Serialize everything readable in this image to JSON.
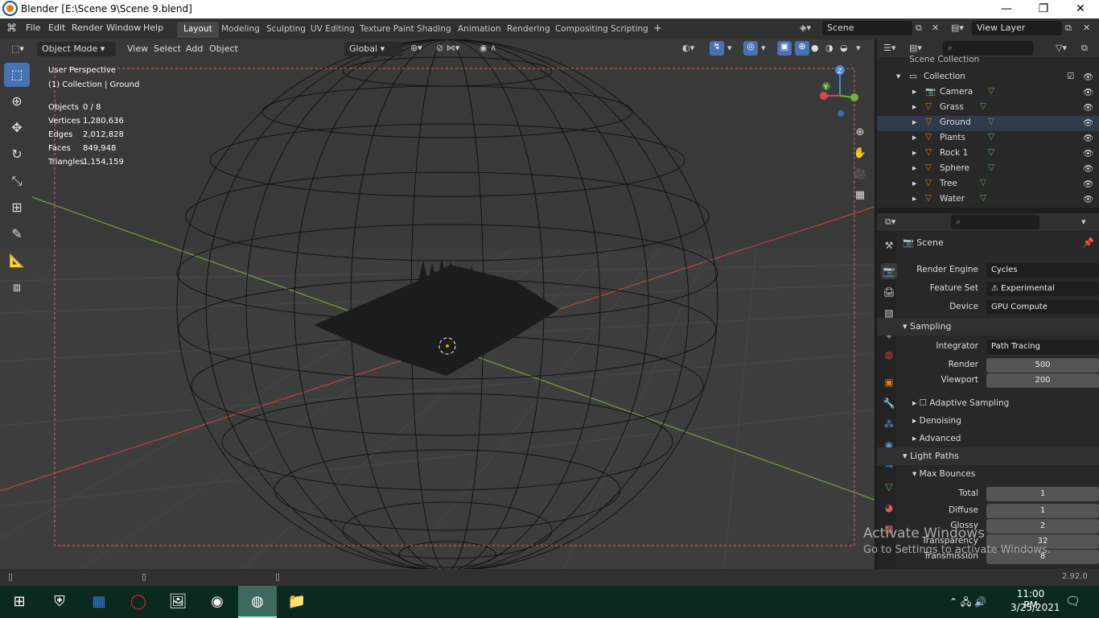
{
  "window": {
    "title": "Blender [E:\\Scene 9\\Scene 9.blend]"
  },
  "menus": [
    "File",
    "Edit",
    "Render",
    "Window",
    "Help"
  ],
  "workspaces": [
    "Layout",
    "Modeling",
    "Sculpting",
    "UV Editing",
    "Texture Paint",
    "Shading",
    "Animation",
    "Rendering",
    "Compositing",
    "Scripting"
  ],
  "scene_field": "Scene",
  "view_layer_field": "View Layer",
  "viewport_header": {
    "mode": "Object Mode",
    "view": "View",
    "select": "Select",
    "add": "Add",
    "object": "Object",
    "transform": "Global"
  },
  "overlay": {
    "perspective": "User Perspective",
    "collection_info": "(1) Collection | Ground",
    "stats": [
      {
        "label": "Objects",
        "value": "0 / 8"
      },
      {
        "label": "Vertices",
        "value": "1,280,636"
      },
      {
        "label": "Edges",
        "value": "2,012,828"
      },
      {
        "label": "Faces",
        "value": "849,948"
      },
      {
        "label": "Triangles",
        "value": "1,154,159"
      }
    ]
  },
  "outliner": {
    "root": "Scene Collection",
    "collection": "Collection",
    "items": [
      "Camera",
      "Grass",
      "Ground",
      "Plants",
      "Rock 1",
      "Sphere",
      "Tree",
      "Water"
    ]
  },
  "properties": {
    "scene_label": "Scene",
    "render_engine_label": "Render Engine",
    "render_engine": "Cycles",
    "feature_set_label": "Feature Set",
    "feature_set": "Experimental",
    "device_label": "Device",
    "device": "GPU Compute",
    "sampling": "Sampling",
    "integrator_label": "Integrator",
    "integrator": "Path Tracing",
    "render_label": "Render",
    "render_value": "500",
    "viewport_label": "Viewport",
    "viewport_value": "200",
    "adaptive": "Adaptive Sampling",
    "denoising": "Denoising",
    "advanced": "Advanced",
    "light_paths": "Light Paths",
    "max_bounces": "Max Bounces",
    "bounces": [
      {
        "label": "Total",
        "value": "1"
      },
      {
        "label": "Diffuse",
        "value": "1"
      },
      {
        "label": "Glossy",
        "value": "2"
      },
      {
        "label": "Transparency",
        "value": "32"
      },
      {
        "label": "Transmission",
        "value": "8"
      }
    ]
  },
  "watermark": {
    "line1": "Activate Windows",
    "line2": "Go to Settings to activate Windows."
  },
  "version": "2.92.0",
  "clock": {
    "time": "11:00 PM",
    "date": "3/25/2021"
  },
  "colors": {
    "accent": "#4772b3",
    "x_axis": "#c84a4a",
    "y_axis": "#7ea63a",
    "taskbar": "#0a2a20"
  }
}
